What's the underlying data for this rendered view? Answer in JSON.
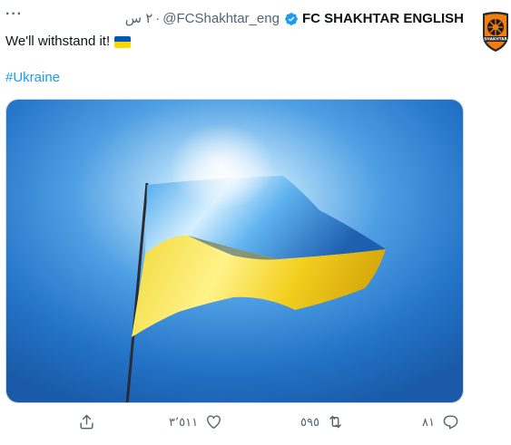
{
  "tweet": {
    "more_label": "···",
    "display_name": "FC SHAKHTAR ENGLISH",
    "handle": "@FCShakhtar_eng",
    "separator": "·",
    "time": "٢ س",
    "text": "We'll withstand it!",
    "hashtag": "#Ukraine",
    "avatar_text": "SHAKHTAR"
  },
  "actions": {
    "reply_count": "٨١",
    "retweet_count": "٥٩٥",
    "like_count": "٣٬٥١١"
  },
  "icons": {
    "more": "more-horizontal-icon",
    "verified": "verified-badge-icon",
    "reply": "reply-icon",
    "retweet": "retweet-icon",
    "like": "heart-icon",
    "share": "share-icon",
    "flag": "ukraine-flag-emoji"
  },
  "colors": {
    "link": "#1d9bf0",
    "muted": "#536471",
    "flag_blue": "#0057b7",
    "flag_yellow": "#ffd700",
    "avatar_orange": "#f27e0f"
  }
}
